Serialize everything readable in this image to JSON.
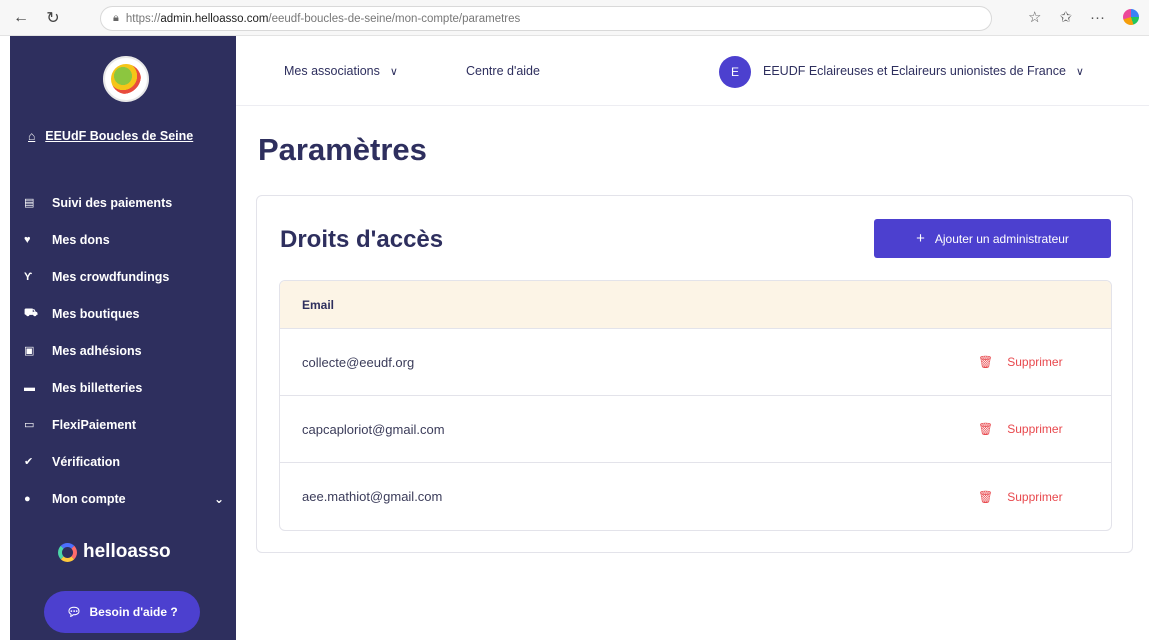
{
  "browser": {
    "url_prefix": "https://",
    "url_host": "admin.helloasso.com",
    "url_path": "/eeudf-boucles-de-seine/mon-compte/parametres"
  },
  "sidebar": {
    "org_name": "EEUdF Boucles de Seine",
    "items": [
      {
        "label": "Suivi des paiements",
        "icon": "chart-icon"
      },
      {
        "label": "Mes dons",
        "icon": "heart-icon"
      },
      {
        "label": "Mes crowdfundings",
        "icon": "sprout-icon"
      },
      {
        "label": "Mes boutiques",
        "icon": "cart-icon"
      },
      {
        "label": "Mes adhésions",
        "icon": "card-icon"
      },
      {
        "label": "Mes billetteries",
        "icon": "ticket-icon"
      },
      {
        "label": "FlexiPaiement",
        "icon": "wallet-icon"
      },
      {
        "label": "Vérification",
        "icon": "check-icon"
      },
      {
        "label": "Mon compte",
        "icon": "user-icon"
      }
    ],
    "brand": "helloasso",
    "help_label": "Besoin d'aide ?"
  },
  "topnav": {
    "associations_label": "Mes associations",
    "help_center_label": "Centre d'aide",
    "avatar_letter": "E",
    "account_name": "EEUDF Eclaireuses et Eclaireurs unionistes de France"
  },
  "main": {
    "page_title": "Paramètres",
    "section_title": "Droits d'accès",
    "add_admin_label": "Ajouter un administrateur",
    "table_header": "Email",
    "rows": [
      {
        "email": "collecte@eeudf.org",
        "action": "Supprimer"
      },
      {
        "email": "capcaploriot@gmail.com",
        "action": "Supprimer"
      },
      {
        "email": "aee.mathiot@gmail.com",
        "action": "Supprimer"
      }
    ]
  },
  "colors": {
    "sidebar_bg": "#2e2f5e",
    "primary": "#4c40cf",
    "danger": "#e8484d",
    "table_header_bg": "#fcf4e6"
  }
}
